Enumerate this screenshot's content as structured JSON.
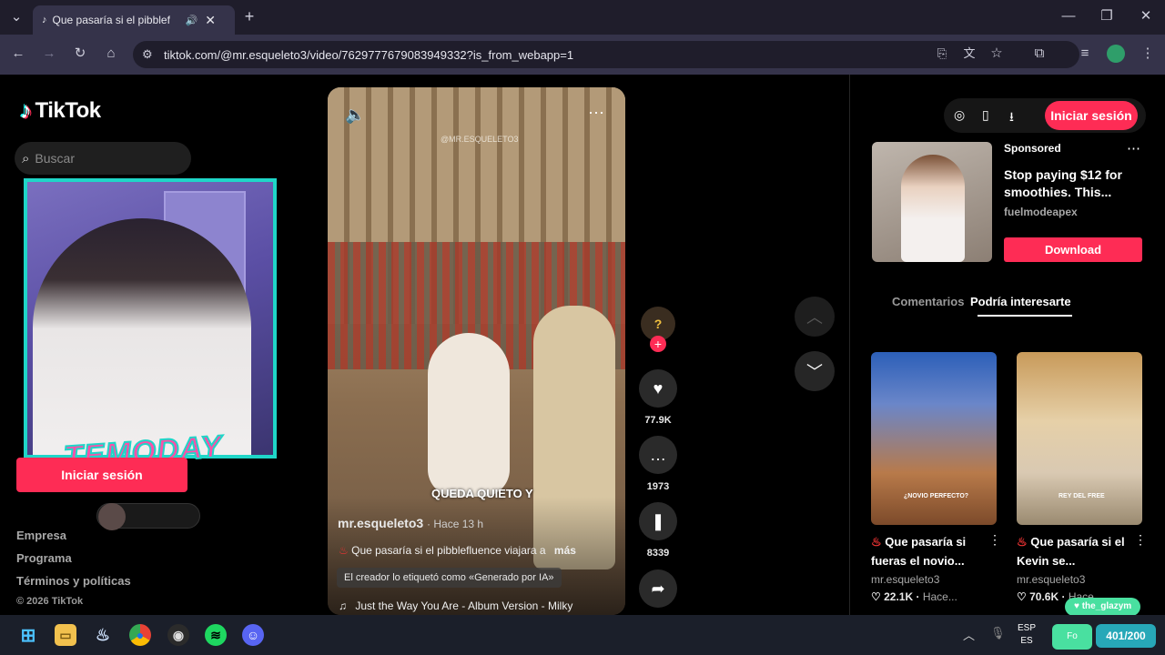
{
  "browser": {
    "tab_title": "Que pasaría si el pibblef",
    "url": "tiktok.com/@mr.esqueleto3/video/7629777679083949332?is_from_webapp=1"
  },
  "sidebar": {
    "logo_text": "TikTok",
    "search_placeholder": "Buscar",
    "login_button": "Iniciar sesión",
    "footer": {
      "company": "Empresa",
      "program": "Programa",
      "terms": "Términos y políticas",
      "copyright": "© 2026 TikTok"
    }
  },
  "video": {
    "watermark": "@MR.ESQUELETO3",
    "caption_overlay": "QUEDA QUIETO Y",
    "author": "mr.esqueleto3",
    "time_ago": "· Hace 13 h",
    "description": "Que pasaría si el pibblefluence viajara a",
    "more_label": "más",
    "ai_label": "El creador lo etiquetó como «Generado por IA»",
    "music": "Just the Way You Are - Album Version - Milky",
    "likes": "77.9K",
    "comments": "1973",
    "saves": "8339"
  },
  "right_panel": {
    "login_button": "Iniciar sesión",
    "ad": {
      "sponsored_label": "Sponsored",
      "title": "Stop paying $12 for smoothies. This...",
      "account": "fuelmodeapex",
      "cta": "Download"
    },
    "tabs": [
      "Comentarios",
      "Podría interesarte"
    ],
    "recommendations": [
      {
        "overlay": "¿NOVIO PERFECTO?",
        "title": "Que pasaría si fueras el novio...",
        "author": "mr.esqueleto3",
        "likes": "22.1K",
        "time": "Hace..."
      },
      {
        "overlay": "REY DEL FREE",
        "title": "Que pasaría si el Kevin se...",
        "author": "mr.esqueleto3",
        "likes": "70.6K",
        "time": "Hace..."
      }
    ]
  },
  "overlay": {
    "stream_logo": "TEMODAY",
    "follow_tag": "the_glazym",
    "follower_goal": "401/200",
    "follow_label": "Fo"
  },
  "taskbar": {
    "lang_top": "ESP",
    "lang_bottom": "ES"
  }
}
